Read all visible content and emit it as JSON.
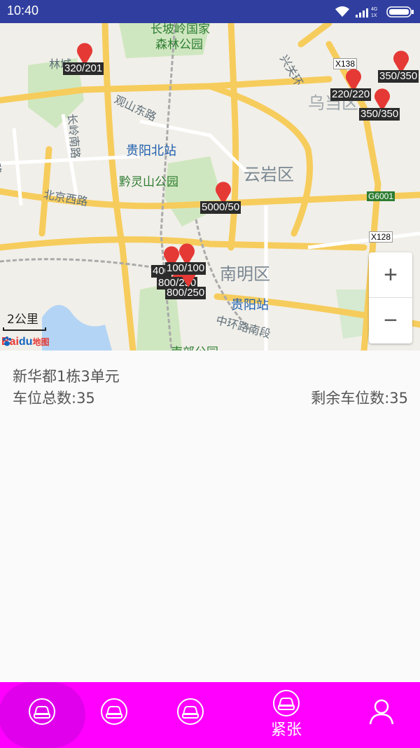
{
  "status_bar": {
    "time": "10:40",
    "net_4g": "4G",
    "net_1x": "1X"
  },
  "map": {
    "labels": {
      "changpoling": "长坡岭国家",
      "forest_park": "森林公园",
      "lincheng": "林城",
      "guanshan_east": "观山东路",
      "jinyang_south": "金阳南路",
      "changling_south": "长岭南路",
      "guiyang_north": "贵阳北站",
      "qianlingshan": "黔灵山公园",
      "yunyan": "云岩区",
      "beijing_west": "北京西路",
      "nanming": "南明区",
      "guiyang_station": "贵阳站",
      "zhonghuan_south": "中环路南段",
      "wudang": "乌当区",
      "xiaoyi": "兴关环",
      "road_x138": "X138",
      "road_x128": "X128",
      "road_g6001": "G6001",
      "nanjiao": "南郊公园"
    },
    "markers": [
      {
        "caption": "320/201"
      },
      {
        "caption": "350/350"
      },
      {
        "caption": "220/220"
      },
      {
        "caption": "350/350"
      },
      {
        "caption": "5000/50"
      },
      {
        "caption": "400"
      },
      {
        "caption": "100/100"
      },
      {
        "caption": "800/250"
      },
      {
        "caption": "800/250"
      }
    ],
    "zoom_in": "+",
    "zoom_out": "−",
    "scale": "2公里",
    "logo_bai": "Bai",
    "logo_du": "du",
    "logo_map": "地图"
  },
  "info": {
    "name": "新华都1栋3单元",
    "total_spaces": "车位总数:35",
    "remaining_spaces": "剩余车位数:35"
  },
  "tabbar": {
    "tabs": [
      {
        "icon": "car-icon",
        "label": ""
      },
      {
        "icon": "car-icon",
        "label": ""
      },
      {
        "icon": "car-icon",
        "label": ""
      },
      {
        "icon": "car-icon",
        "label": "紧张"
      },
      {
        "icon": "user-icon",
        "label": ""
      }
    ]
  },
  "colors": {
    "status_bar": "#303f9f",
    "tab_bar": "#ff00ff",
    "marker": "#e53935"
  }
}
